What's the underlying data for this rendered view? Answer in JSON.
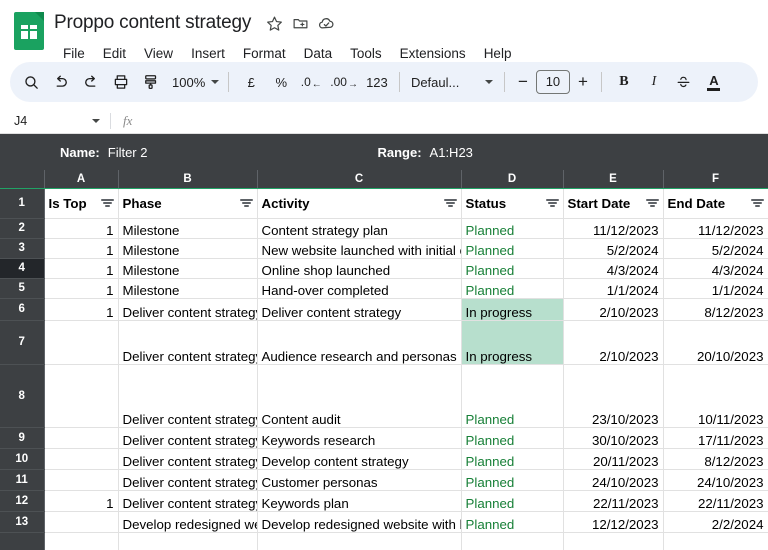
{
  "app": {
    "logo_icon": "google-sheets-icon",
    "doc_title": "Proppo content strategy",
    "title_icons": [
      {
        "name": "star-icon",
        "label": "Star"
      },
      {
        "name": "move-to-folder-icon",
        "label": "Move"
      },
      {
        "name": "cloud-saved-icon",
        "label": "Saved to Drive"
      }
    ],
    "menus": [
      "File",
      "Edit",
      "View",
      "Insert",
      "Format",
      "Data",
      "Tools",
      "Extensions",
      "Help"
    ]
  },
  "toolbar": {
    "search_icon": "search-icon",
    "undo_icon": "undo-icon",
    "redo_icon": "redo-icon",
    "print_icon": "print-icon",
    "paint_format_icon": "paint-format-icon",
    "zoom_value": "100%",
    "currency_label": "£",
    "percent_label": "%",
    "decrease_decimal_label": ".0",
    "increase_decimal_label": ".00",
    "more_formats_label": "123",
    "font_name": "Defaul...",
    "font_size": "10",
    "decrease_font_label": "−",
    "increase_font_label": "+",
    "bold_label": "B",
    "italic_label": "I",
    "strikethrough_label": "S",
    "text_color_label": "A"
  },
  "formula_bar": {
    "name_box": "J4",
    "fx_label": "fx",
    "formula_value": ""
  },
  "filter_view": {
    "name_label": "Name:",
    "name_value": "Filter 2",
    "range_label": "Range:",
    "range_value": "A1:H23"
  },
  "grid": {
    "column_letters": [
      "A",
      "B",
      "C",
      "D",
      "E",
      "F"
    ],
    "headers": [
      "Is Top",
      "Phase",
      "Activity",
      "Status",
      "Start Date",
      "End Date"
    ],
    "active_row": "4",
    "rows": [
      {
        "n": "1",
        "cells": [
          "Is Top",
          "Phase",
          "Activity",
          "Status",
          "Start Date",
          "End Date"
        ],
        "type": "header"
      },
      {
        "n": "2",
        "cells": [
          "1",
          "Milestone",
          "Content strategy plan",
          "Planned",
          "11/12/2023",
          "11/12/2023"
        ]
      },
      {
        "n": "3",
        "cells": [
          "1",
          "Milestone",
          "New website launched with initial c",
          "Planned",
          "5/2/2024",
          "5/2/2024"
        ]
      },
      {
        "n": "4",
        "cells": [
          "1",
          "Milestone",
          "Online shop launched",
          "Planned",
          "4/3/2024",
          "4/3/2024"
        ]
      },
      {
        "n": "5",
        "cells": [
          "1",
          "Milestone",
          "Hand-over completed",
          "Planned",
          "1/1/2024",
          "1/1/2024"
        ]
      },
      {
        "n": "6",
        "cells": [
          "1",
          "Deliver content strategy",
          "Deliver content strategy",
          "In progress",
          "2/10/2023",
          "8/12/2023"
        ]
      },
      {
        "n": "7",
        "cells": [
          "",
          "Deliver content strategy",
          "Audience research and personas",
          "In progress",
          "2/10/2023",
          "20/10/2023"
        ]
      },
      {
        "n": "8",
        "cells": [
          "",
          "Deliver content strategy",
          "Content audit",
          "Planned",
          "23/10/2023",
          "10/11/2023"
        ]
      },
      {
        "n": "9",
        "cells": [
          "",
          "Deliver content strategy",
          "Keywords research",
          "Planned",
          "30/10/2023",
          "17/11/2023"
        ]
      },
      {
        "n": "10",
        "cells": [
          "",
          "Deliver content strategy",
          "Develop content strategy",
          "Planned",
          "20/11/2023",
          "8/12/2023"
        ]
      },
      {
        "n": "11",
        "cells": [
          "",
          "Deliver content strategy",
          "Customer personas",
          "Planned",
          "24/10/2023",
          "24/10/2023"
        ]
      },
      {
        "n": "12",
        "cells": [
          "1",
          "Deliver content strategy",
          "Keywords plan",
          "Planned",
          "22/11/2023",
          "22/11/2023"
        ]
      },
      {
        "n": "13",
        "cells": [
          "",
          "Develop redesigned we",
          "Develop redesigned website with b",
          "Planned",
          "12/12/2023",
          "2/2/2024"
        ]
      },
      {
        "n": "",
        "cells": [
          "",
          "",
          "",
          "",
          "",
          ""
        ]
      }
    ]
  },
  "colors": {
    "brand_green": "#1aa260",
    "filter_bar_bg": "#3d4043",
    "in_progress_bg": "#b7dfcd",
    "planned_text": "#188038",
    "toolbar_bg": "#edf2fa"
  }
}
